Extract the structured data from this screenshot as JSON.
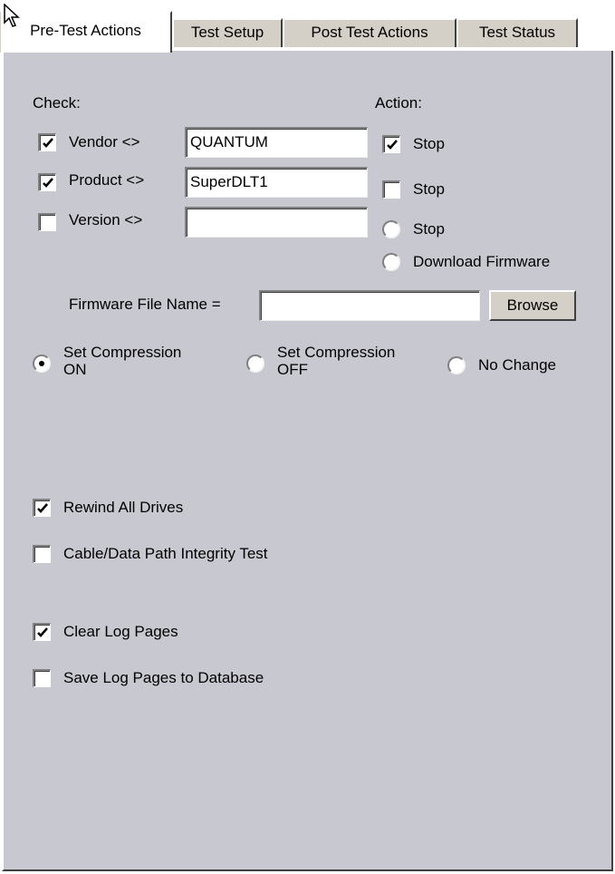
{
  "tabs": [
    "Pre-Test Actions",
    "Test Setup",
    "Post Test Actions",
    "Test Status"
  ],
  "check_header": "Check:",
  "action_header": "Action:",
  "checks": [
    {
      "label": "Vendor <>",
      "checked": true,
      "value": "QUANTUM"
    },
    {
      "label": "Product <>",
      "checked": true,
      "value": "SuperDLT1"
    },
    {
      "label": "Version <>",
      "checked": false,
      "value": ""
    }
  ],
  "actions": [
    {
      "label": "Stop",
      "kind": "checkbox",
      "checked": true
    },
    {
      "label": "Stop",
      "kind": "checkbox",
      "checked": false
    },
    {
      "label": "Stop",
      "kind": "radio",
      "selected": false
    },
    {
      "label": "Download Firmware",
      "kind": "radio",
      "selected": false
    }
  ],
  "firmware": {
    "label": "Firmware File Name =",
    "value": "",
    "browse_label": "Browse"
  },
  "compression": {
    "on": {
      "line1": "Set Compression",
      "line2": "ON",
      "selected": true
    },
    "off": {
      "line1": "Set Compression",
      "line2": "OFF",
      "selected": false
    },
    "nochange": {
      "label": "No Change",
      "selected": false
    }
  },
  "options": [
    {
      "label": "Rewind All Drives",
      "checked": true
    },
    {
      "label": "Cable/Data Path Integrity Test",
      "checked": false
    },
    {
      "label": "Clear Log Pages",
      "checked": true
    },
    {
      "label": "Save Log Pages to Database",
      "checked": false
    }
  ]
}
